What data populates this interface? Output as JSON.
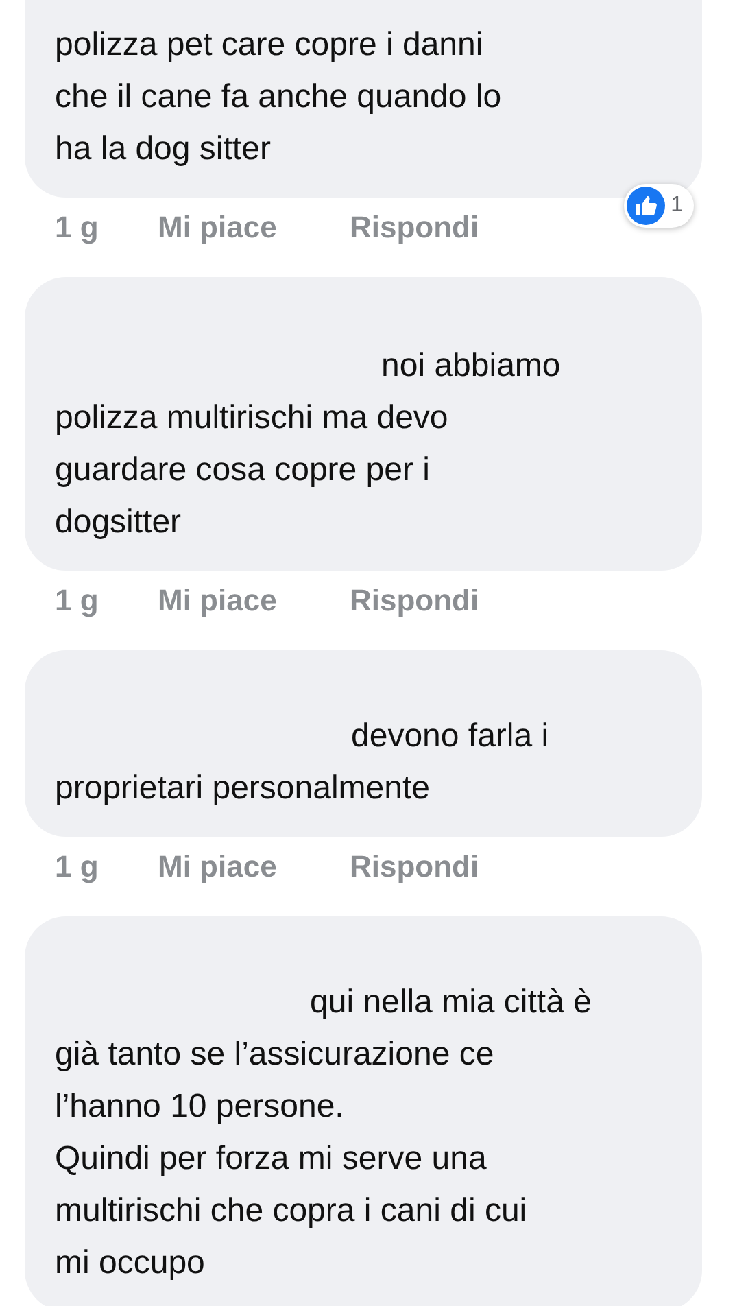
{
  "comments": [
    {
      "lines": [
        "polizza pet care copre i danni",
        "che il cane fa anche quando lo",
        "ha la dog sitter"
      ],
      "time": "1 g",
      "like": "Mi piace",
      "reply": "Rispondi",
      "reactions": {
        "count": "1"
      }
    },
    {
      "lines": [
        "noi abbiamo",
        "polizza multirischi ma devo",
        "guardare cosa copre per i",
        "dogsitter"
      ],
      "time": "1 g",
      "like": "Mi piace",
      "reply": "Rispondi"
    },
    {
      "lines": [
        "devono farla i",
        "proprietari personalmente"
      ],
      "time": "1 g",
      "like": "Mi piace",
      "reply": "Rispondi"
    },
    {
      "lines": [
        "qui nella mia città è",
        "già tanto se l’assicurazione ce",
        "l’hanno 10 persone.",
        "Quindi per forza mi serve una",
        "multirischi che copra i cani di cui",
        "mi occupo"
      ]
    }
  ]
}
